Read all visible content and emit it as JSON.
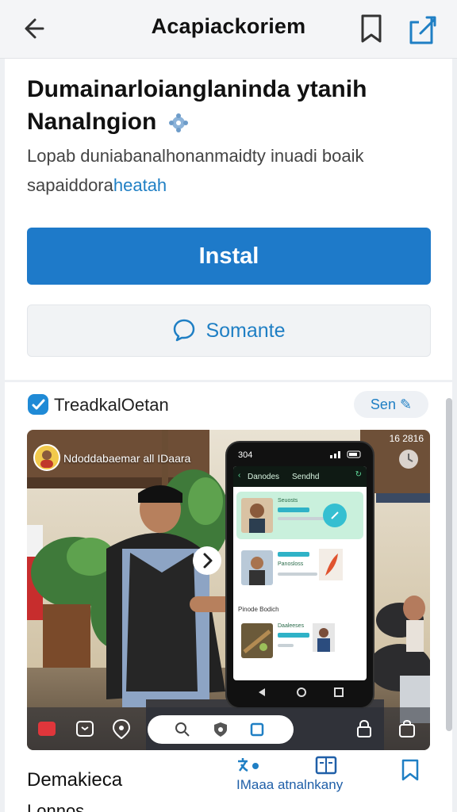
{
  "topbar": {
    "title": "Acapiackoriem"
  },
  "app": {
    "title": "Dumainarloianglaninda ytanih Nanalngion",
    "description_main": "Lopab duniabanalhonanmaidty inuadi boaik sapaiddora",
    "description_highlight": "heatah"
  },
  "buttons": {
    "install": "Instal",
    "secondary": "Somante"
  },
  "section": {
    "title": "TreadkalOetan",
    "see": "Sen"
  },
  "media": {
    "caption": "Ndoddabaemar all IDaara",
    "time": "16 2816",
    "phone": {
      "status": "304",
      "header_left": "Danodes",
      "header_right": "Sendhd",
      "tile_label_1": "Seuosts",
      "tile_label_2": "Panosloss",
      "tile_label_3": "Daaleeses",
      "section_label": "Pinode Bodich"
    }
  },
  "bottom": {
    "left_title": "Demakieca",
    "left_sub": "Lonnos",
    "action_label": "IMaaa atnalnkany"
  },
  "colors": {
    "accent": "#1e7ac9",
    "link": "#1f7fc4",
    "mint": "#c9f0dc",
    "teal": "#35bfd1"
  }
}
